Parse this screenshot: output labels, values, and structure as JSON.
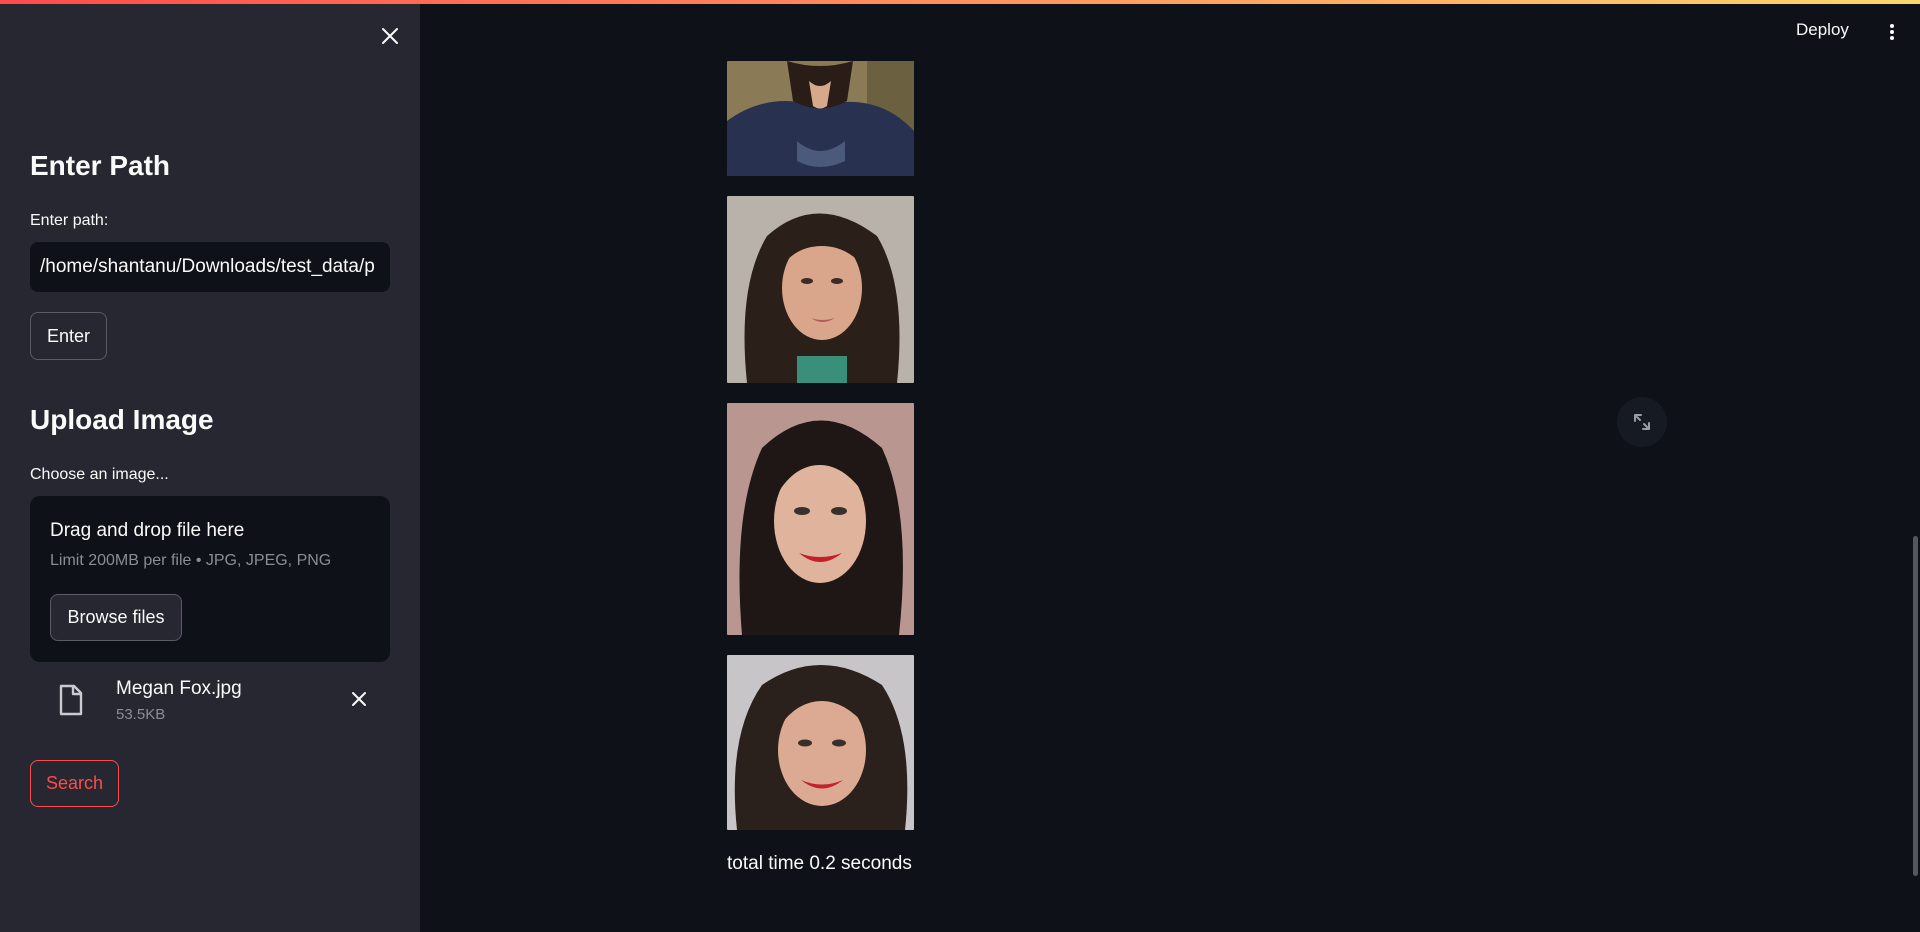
{
  "toolbar": {
    "deploy_label": "Deploy",
    "menu_icon": "kebab-menu-icon"
  },
  "sidebar": {
    "close_icon": "close-icon",
    "path_section": {
      "heading": "Enter Path",
      "field_label": "Enter path:",
      "field_value": "/home/shantanu/Downloads/test_data/p",
      "enter_label": "Enter"
    },
    "upload_section": {
      "heading": "Upload Image",
      "field_label": "Choose an image...",
      "dropzone_title": "Drag and drop file here",
      "dropzone_hint": "Limit 200MB per file • JPG, JPEG, PNG",
      "browse_label": "Browse files",
      "file": {
        "name": "Megan Fox.jpg",
        "size": "53.5KB",
        "icon": "file-icon",
        "remove_icon": "close-icon"
      }
    },
    "search_label": "Search"
  },
  "main": {
    "results": [
      {
        "name": "result-image-1",
        "icon": "portrait-photo"
      },
      {
        "name": "result-image-2",
        "icon": "portrait-photo"
      },
      {
        "name": "result-image-3",
        "icon": "portrait-photo"
      },
      {
        "name": "result-image-4",
        "icon": "portrait-photo"
      }
    ],
    "fullscreen_icon": "fullscreen-icon",
    "total_time": "total time 0.2 seconds"
  },
  "colors": {
    "app_background": "#0e1117",
    "sidebar_background": "#262730",
    "accent": "#ff4b4b",
    "muted_text": "#8b8d95"
  }
}
